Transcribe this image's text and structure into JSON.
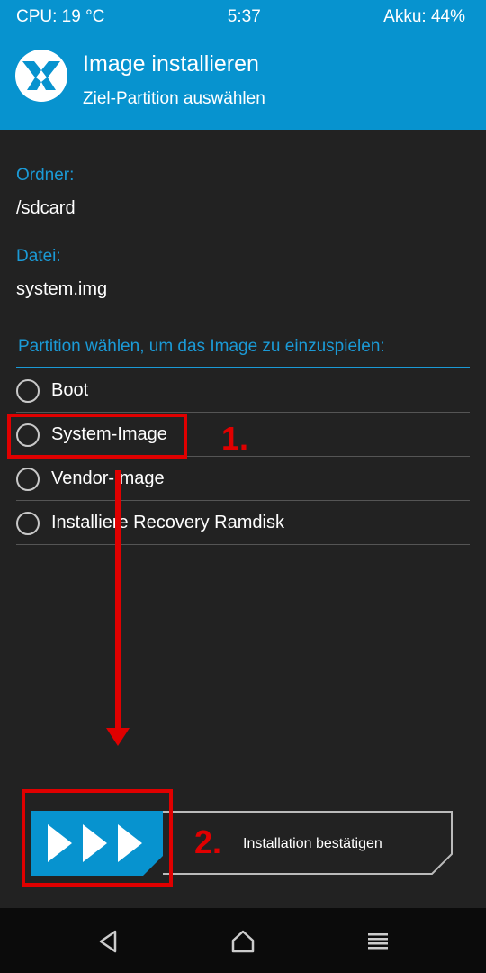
{
  "status_bar": {
    "cpu": "CPU: 19 °C",
    "time": "5:37",
    "battery": "Akku: 44%"
  },
  "header": {
    "logo_icon": "twrp-logo-icon",
    "title": "Image installieren",
    "subtitle": "Ziel-Partition auswählen"
  },
  "folder": {
    "label": "Ordner:",
    "value": "/sdcard"
  },
  "file": {
    "label": "Datei:",
    "value": "system.img"
  },
  "partition": {
    "title": "Partition wählen, um das Image zu einzuspielen:",
    "options": [
      {
        "label": "Boot",
        "selected": false
      },
      {
        "label": "System-Image",
        "selected": false
      },
      {
        "label": "Vendor-Image",
        "selected": false
      },
      {
        "label": "Installiere Recovery Ramdisk",
        "selected": false
      }
    ]
  },
  "annotations": {
    "step1": "1.",
    "step2": "2.",
    "color": "#e00000"
  },
  "swipe": {
    "label": "Installation bestätigen",
    "icon": "triple-chevron-right-icon"
  },
  "nav": {
    "back_icon": "back-triangle-icon",
    "home_icon": "home-icon",
    "menu_icon": "menu-lines-icon"
  },
  "colors": {
    "accent": "#0793cf",
    "label_blue": "#1b9ad6",
    "background": "#222222"
  }
}
